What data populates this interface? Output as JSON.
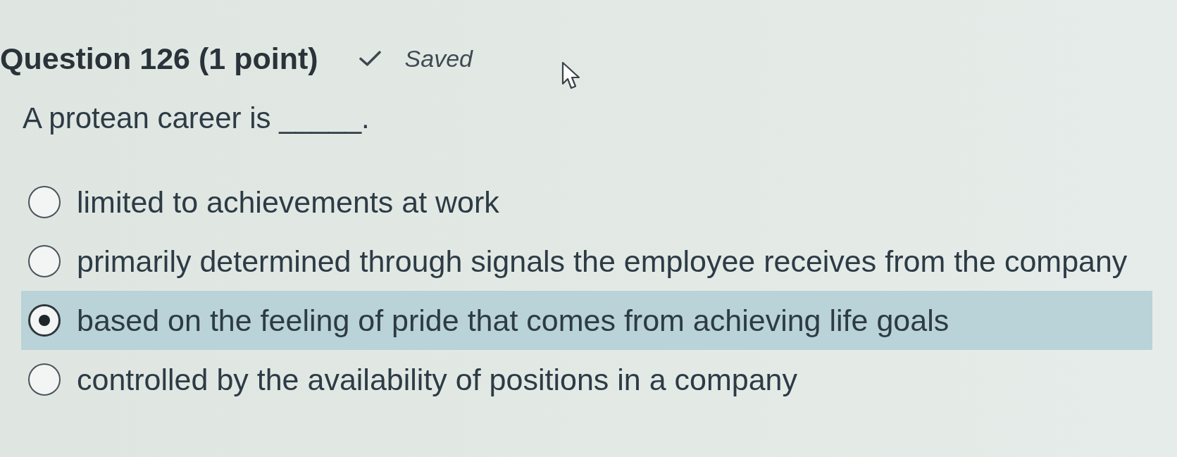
{
  "question": {
    "title": "Question 126 (1 point)",
    "status": "Saved",
    "prompt": "A protean career is _____."
  },
  "options": [
    {
      "label": "limited to achievements at work",
      "selected": false
    },
    {
      "label": "primarily determined through signals the employee receives from the company",
      "selected": false
    },
    {
      "label": "based on the feeling of pride that comes from achieving life goals",
      "selected": true
    },
    {
      "label": "controlled by the availability of positions in a company",
      "selected": false
    }
  ]
}
